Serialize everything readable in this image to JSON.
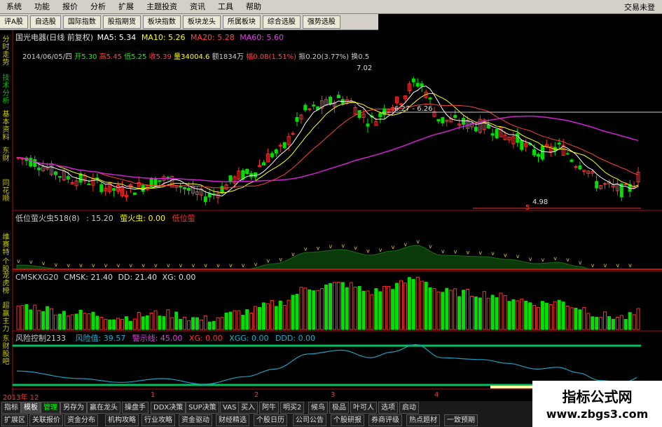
{
  "menu": {
    "items": [
      "系统",
      "功能",
      "报价",
      "分析",
      "扩展",
      "主题投资",
      "资讯",
      "工具",
      "帮助"
    ],
    "right_text": "交易未登"
  },
  "toolbar": {
    "buttons": [
      "评A股",
      "自选股",
      "国际指数",
      "股指期货",
      "板块指数",
      "板块龙头",
      "所属板块",
      "综合选股",
      "强势选股"
    ]
  },
  "side_tabs": [
    "分时走势",
    "技术分析",
    "基本资料",
    "东财",
    "同花顺",
    "维赛特",
    "个股",
    "龙虎榜",
    "超赢主力",
    "东财股吧"
  ],
  "price_panel": {
    "title": "国光电器(日线 前复权)",
    "ma5_label": "MA5: 5.34",
    "ma10_label": "MA10: 5.26",
    "ma20_label": "MA20: 5.28",
    "ma60_label": "MA60: 5.60",
    "date": "2014/06/05/四",
    "open": "开5.30",
    "high": "高5.45",
    "low": "低5.25",
    "close": "收5.39",
    "volume": "量34004.6",
    "amount": "额1834万",
    "change": "幅0.08(1.51%)",
    "amplitude": "振0.20(3.77%)",
    "turnover": "换0.5",
    "high_mark": "7.02",
    "mid_mark": "6.27 - 6.26",
    "low_mark": "4.98",
    "count_mark": "5"
  },
  "firefly_panel": {
    "title": "低位萤火虫518(8)",
    "value1": ": 15.20",
    "label2": "萤火虫: 0.00",
    "label3": "低位萤"
  },
  "cmsk_panel": {
    "title": "CMSKXG20",
    "cmsk": "CMSK: 21.40",
    "dd": "DD: 21.40",
    "xg": "XG: 0.00"
  },
  "risk_panel": {
    "title": "风险控制2133",
    "risk": "风险值: 39.57",
    "warn": "警示线: 45.00",
    "xg": "XG: 0.00",
    "xgg": "XGG: 0.00",
    "ddd": "DDD: 0.00"
  },
  "time_axis": {
    "year": "2013年 12",
    "months": [
      "1",
      "2",
      "3",
      "4"
    ]
  },
  "bottom_tabs": {
    "row1": [
      "指标",
      "模板",
      "管理",
      "另存为",
      "赢在龙头",
      "操盘手",
      "DDX决策",
      "SUP决策",
      "VAS",
      "买入",
      "阿牛",
      "明买2",
      "候鸟",
      "极品",
      "叶可人",
      "选项",
      "启动"
    ],
    "row2": [
      "扩展区",
      "关联报价",
      "资金分布",
      "机构攻略",
      "行业攻略",
      "资金驱动",
      "财经精选",
      "个股日历",
      "公司公告",
      "个股研报",
      "券商评级",
      "热点题材",
      "一致预期"
    ]
  },
  "watermark": {
    "line1": "指标公式网",
    "line2": "www.zbgs3.com"
  },
  "colors": {
    "up": "#ff3030",
    "down": "#00e000",
    "ma5": "#ffffff",
    "ma10": "#ffff00",
    "ma20": "#ff4040",
    "ma60": "#d020d0",
    "risk_line": "#1aa0c0",
    "warn_line": "#00c060"
  }
}
